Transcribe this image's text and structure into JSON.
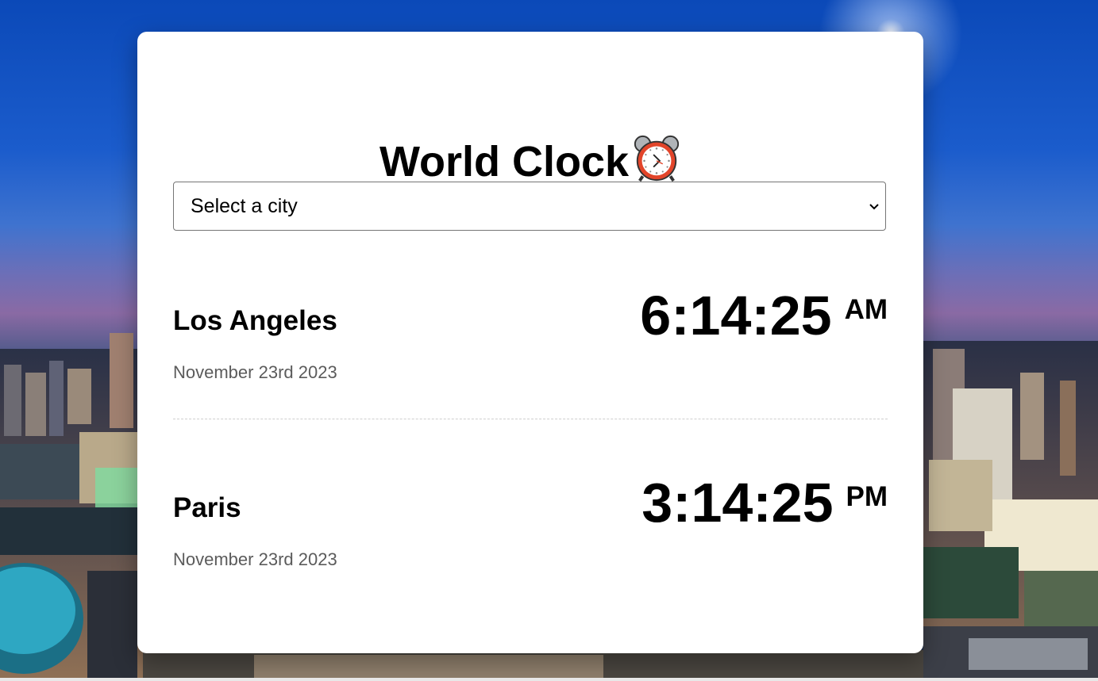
{
  "app": {
    "title": "World Clock",
    "title_icon": "alarm-clock-icon"
  },
  "city_select": {
    "selected": "Select a city",
    "icon": "chevron-down-icon"
  },
  "cities": [
    {
      "name": "Los Angeles",
      "date": "November 23rd 2023",
      "time": "6:14:25",
      "period": "AM"
    },
    {
      "name": "Paris",
      "date": "November 23rd 2023",
      "time": "3:14:25",
      "period": "PM"
    }
  ],
  "colors": {
    "card_background": "#ffffff",
    "date_text": "#5b5b5b",
    "divider": "#cfcfcf",
    "sky_top": "#0b49b8"
  }
}
